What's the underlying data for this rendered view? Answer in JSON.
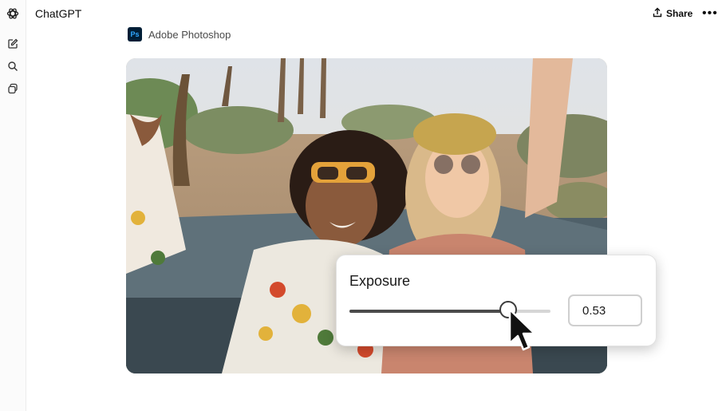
{
  "app": {
    "title": "ChatGPT"
  },
  "rail": {
    "icons": [
      "openai-logo-icon",
      "new-chat-icon",
      "search-icon",
      "library-icon"
    ]
  },
  "header": {
    "share_label": "Share",
    "more_label": "•••"
  },
  "tool": {
    "badge": "Ps",
    "name": "Adobe Photoshop"
  },
  "exposure": {
    "title": "Exposure",
    "value_text": "0.53",
    "slider_fraction": 0.79
  },
  "colors": {
    "ps_badge_bg": "#001e36",
    "ps_badge_text": "#31a8ff",
    "slider_fill": "#4b4b4b"
  }
}
